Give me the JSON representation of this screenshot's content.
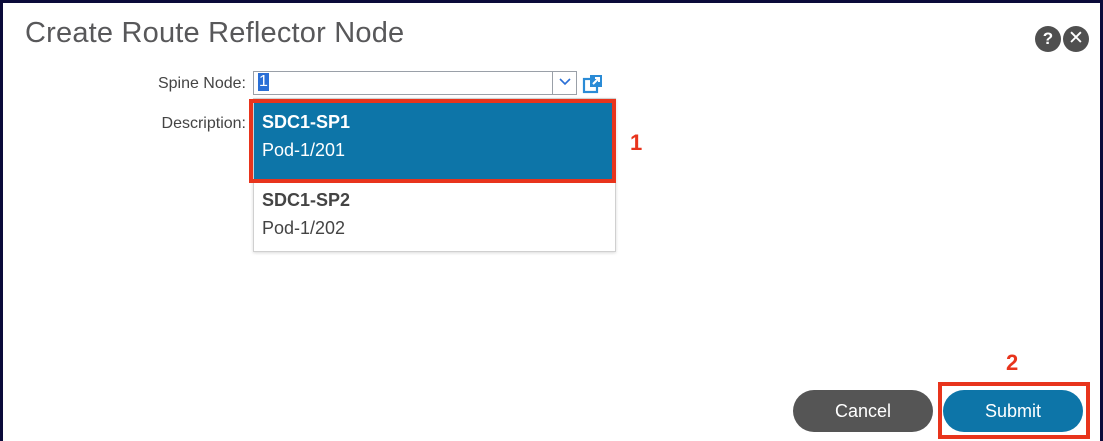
{
  "dialog": {
    "title": "Create Route Reflector Node",
    "help_icon": "help-icon",
    "close_icon": "close-icon"
  },
  "form": {
    "spine_label": "Spine Node:",
    "spine_value": "1",
    "description_label": "Description:"
  },
  "dropdown": {
    "options": [
      {
        "name": "SDC1-SP1",
        "pod": "Pod-1/201",
        "selected": true
      },
      {
        "name": "SDC1-SP2",
        "pod": "Pod-1/202",
        "selected": false
      }
    ]
  },
  "annotations": {
    "step1": "1",
    "step2": "2"
  },
  "buttons": {
    "cancel": "Cancel",
    "submit": "Submit"
  },
  "colors": {
    "accent": "#0d75a8",
    "highlight": "#e8341c",
    "cancel": "#555555"
  }
}
